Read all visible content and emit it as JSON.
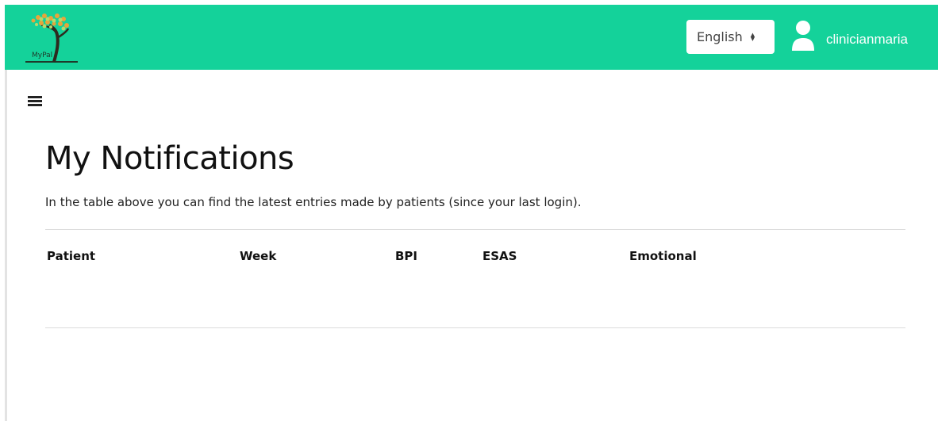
{
  "header": {
    "logo_text": "MyPal",
    "language_select": {
      "selected": "English"
    },
    "user": {
      "name": "clinicianmaria"
    },
    "colors": {
      "navbar": "#14d29a",
      "user_text": "#ffffff"
    }
  },
  "menu": {
    "icon": "hamburger-menu-icon"
  },
  "main": {
    "title": "My Notifications",
    "subtitle": "In the table above you can find the latest entries made by patients (since your last login).",
    "table": {
      "columns": [
        "Patient",
        "Week",
        "BPI",
        "ESAS",
        "Emotional"
      ],
      "rows": []
    }
  }
}
